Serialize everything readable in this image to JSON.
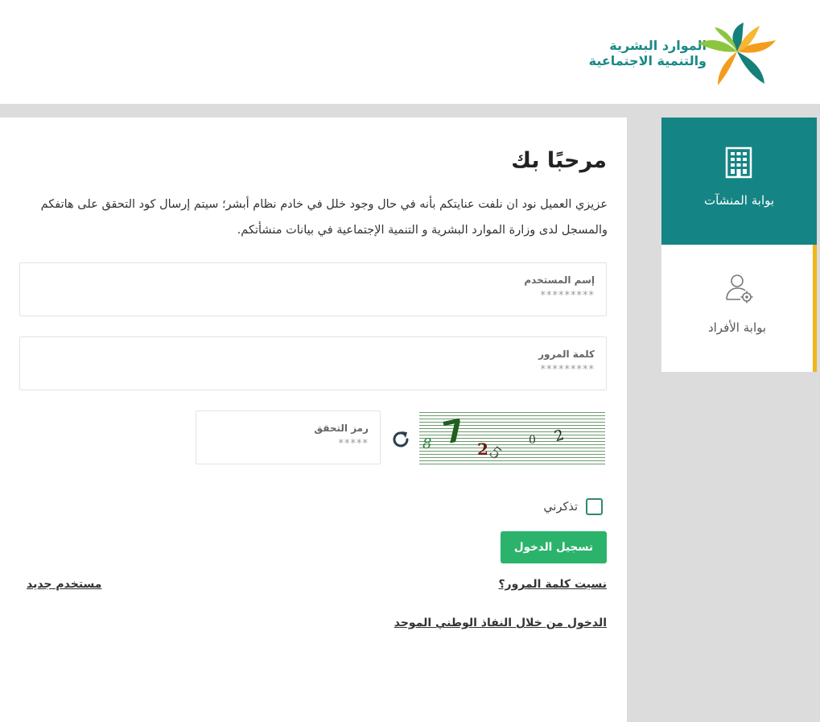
{
  "header": {
    "logo_line1": "الموارد البشرية",
    "logo_line2": "والتنمية الاجتماعية",
    "logo_colors": {
      "teal": "#138079",
      "orange": "#f39c1d",
      "green": "#8cc63f"
    }
  },
  "sidebar": {
    "establishments_label": "بوابة المنشآت",
    "establishments_icon": "building-icon",
    "individuals_label": "بوابة الأفراد",
    "individuals_icon": "user-settings-icon",
    "active_color": "#158484",
    "accent_color": "#f1b51c"
  },
  "main": {
    "welcome": "مرحبًا بك",
    "intro": "عزيزي العميل نود ان نلفت عنايتكم بأنه في حال وجود خلل في خادم نظام أبشر؛ سيتم إرسال كود التحقق على هاتفكم والمسجل لدى وزارة الموارد البشرية و التنمية الإجتماعية في بيانات منشأتكم.",
    "username": {
      "label": "إسم المستخدم",
      "placeholder": "*********",
      "value": ""
    },
    "password": {
      "label": "كلمة المرور",
      "placeholder": "*********",
      "value": ""
    },
    "captcha": {
      "label": "رمز التحقق",
      "placeholder": "*****",
      "value": ""
    },
    "captcha_chars": [
      "8",
      "7",
      "2",
      "5",
      "0",
      "2"
    ],
    "remember_label": "تذكرني",
    "login_button": "تسجيل الدخول",
    "forgot_password": "نسيت كلمة المرور؟",
    "new_user": "مستخدم جديد",
    "nafath_login": "الدخول من خلال النفاذ الوطني الموحد",
    "button_color": "#2bb36b"
  }
}
